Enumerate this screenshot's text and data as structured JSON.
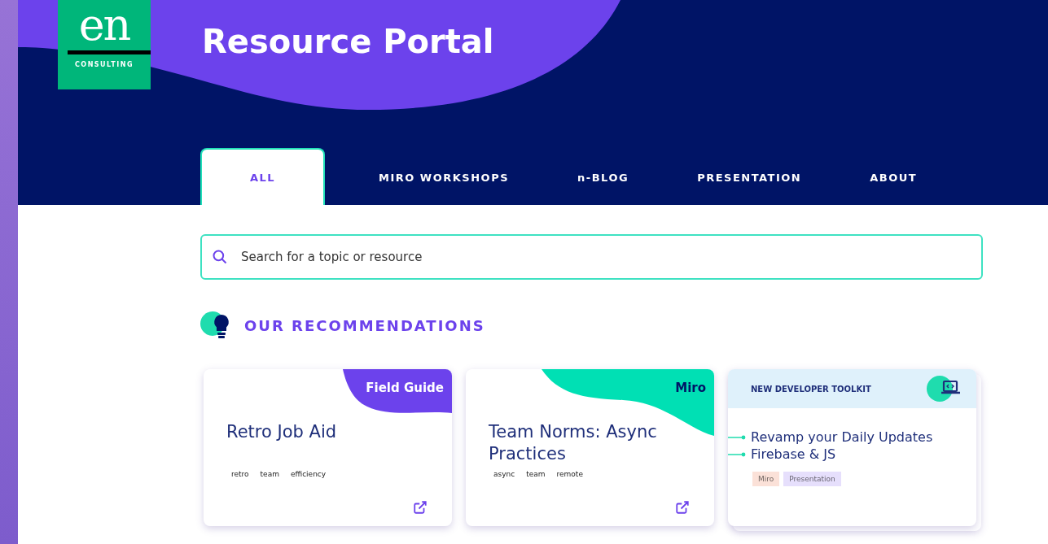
{
  "logo": {
    "mark": "en",
    "subtitle": "CONSULTING"
  },
  "title": "Resource Portal",
  "tabs": [
    {
      "label": "ALL",
      "selected": true
    },
    {
      "label": "MIRO WORKSHOPS",
      "selected": false
    },
    {
      "label": "n-BLOG",
      "selected": false
    },
    {
      "label": "PRESENTATION",
      "selected": false
    },
    {
      "label": "ABOUT",
      "selected": false
    }
  ],
  "search": {
    "placeholder": "Search for a topic or resource"
  },
  "section": {
    "title": "OUR RECOMMENDATIONS"
  },
  "cards": [
    {
      "kind": "ribbon",
      "badge": "Field Guide",
      "color": "#6c42ec",
      "title": "Retro Job Aid",
      "tags": [
        "retro",
        "team",
        "efficiency"
      ]
    },
    {
      "kind": "ribbon",
      "badge": "Miro",
      "color": "#00e0b4",
      "title": "Team Norms: Async Practices",
      "tags": [
        "async",
        "team",
        "remote"
      ]
    },
    {
      "kind": "toolkit",
      "header": "NEW DEVELOPER TOOLKIT",
      "items": [
        "Revamp your Daily Updates",
        "Firebase & JS"
      ],
      "labels": [
        {
          "text": "Miro",
          "color": "#fbe1d8"
        },
        {
          "text": "Presentation",
          "color": "#e6dffc"
        }
      ]
    }
  ]
}
